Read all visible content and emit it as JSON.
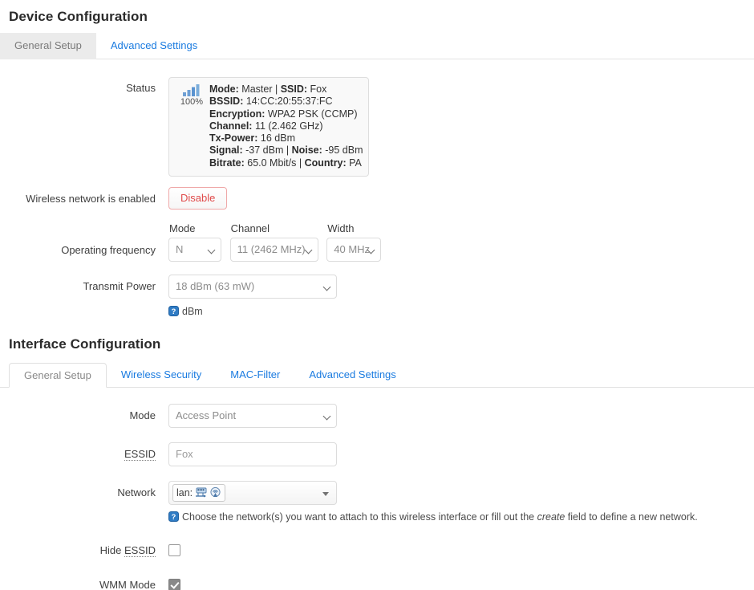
{
  "device_section": {
    "title": "Device Configuration",
    "tabs": [
      {
        "label": "General Setup",
        "active": true
      },
      {
        "label": "Advanced Settings",
        "active": false
      }
    ],
    "status_row": {
      "label": "Status",
      "signal_icon": "signal-bars-icon",
      "signal_percent": "100%",
      "lines": [
        {
          "pairs": [
            {
              "key": "Mode:",
              "value": "Master"
            },
            {
              "key": "SSID:",
              "value": "Fox"
            }
          ],
          "sep": " | "
        },
        {
          "pairs": [
            {
              "key": "BSSID:",
              "value": "14:CC:20:55:37:FC"
            }
          ],
          "sep": ""
        },
        {
          "pairs": [
            {
              "key": "Encryption:",
              "value": "WPA2 PSK (CCMP)"
            }
          ],
          "sep": ""
        },
        {
          "pairs": [
            {
              "key": "Channel:",
              "value": "11 (2.462 GHz)"
            }
          ],
          "sep": ""
        },
        {
          "pairs": [
            {
              "key": "Tx-Power:",
              "value": "16 dBm"
            }
          ],
          "sep": ""
        },
        {
          "pairs": [
            {
              "key": "Signal:",
              "value": "-37 dBm"
            },
            {
              "key": "Noise:",
              "value": "-95 dBm"
            }
          ],
          "sep": " | "
        },
        {
          "pairs": [
            {
              "key": "Bitrate:",
              "value": "65.0 Mbit/s"
            },
            {
              "key": "Country:",
              "value": "PA"
            }
          ],
          "sep": " | "
        }
      ]
    },
    "enabled_row": {
      "label": "Wireless network is enabled",
      "button_label": "Disable",
      "button_color": "#e04b4b",
      "button_border": "#efa8a8"
    },
    "frequency_row": {
      "label": "Operating frequency",
      "mode": {
        "heading": "Mode",
        "value": "N"
      },
      "channel": {
        "heading": "Channel",
        "value": "11 (2462 MHz)"
      },
      "width": {
        "heading": "Width",
        "value": "40 MHz"
      }
    },
    "txpower_row": {
      "label": "Transmit Power",
      "value": "18 dBm (63 mW)",
      "help_icon": "help-question-icon",
      "help_text": "dBm"
    }
  },
  "interface_section": {
    "title": "Interface Configuration",
    "tabs": [
      {
        "label": "General Setup",
        "active": true
      },
      {
        "label": "Wireless Security",
        "active": false
      },
      {
        "label": "MAC-Filter",
        "active": false
      },
      {
        "label": "Advanced Settings",
        "active": false
      }
    ],
    "mode_row": {
      "label": "Mode",
      "value": "Access Point"
    },
    "essid_row": {
      "label": "ESSID",
      "value": "Fox"
    },
    "network_row": {
      "label": "Network",
      "chip_label": "lan:",
      "chip_icons": [
        "ethernet-switch-icon",
        "wifi-antenna-icon"
      ],
      "help_icon": "help-question-icon",
      "help_prefix": "Choose the network(s) you want to attach to this wireless interface or fill out the ",
      "help_italic": "create",
      "help_suffix": " field to define a new network."
    },
    "hide_essid_row": {
      "label_prefix": "Hide ",
      "label_abbr": "ESSID",
      "checked": false
    },
    "wmm_row": {
      "label": "WMM Mode",
      "checked": true
    }
  },
  "theme": {
    "link_color": "#1a7be0",
    "active_tab_bg": "#ebebeb",
    "border_color": "#e2e2e2",
    "text_color": "#404040",
    "muted_color": "#8c8c8c"
  }
}
